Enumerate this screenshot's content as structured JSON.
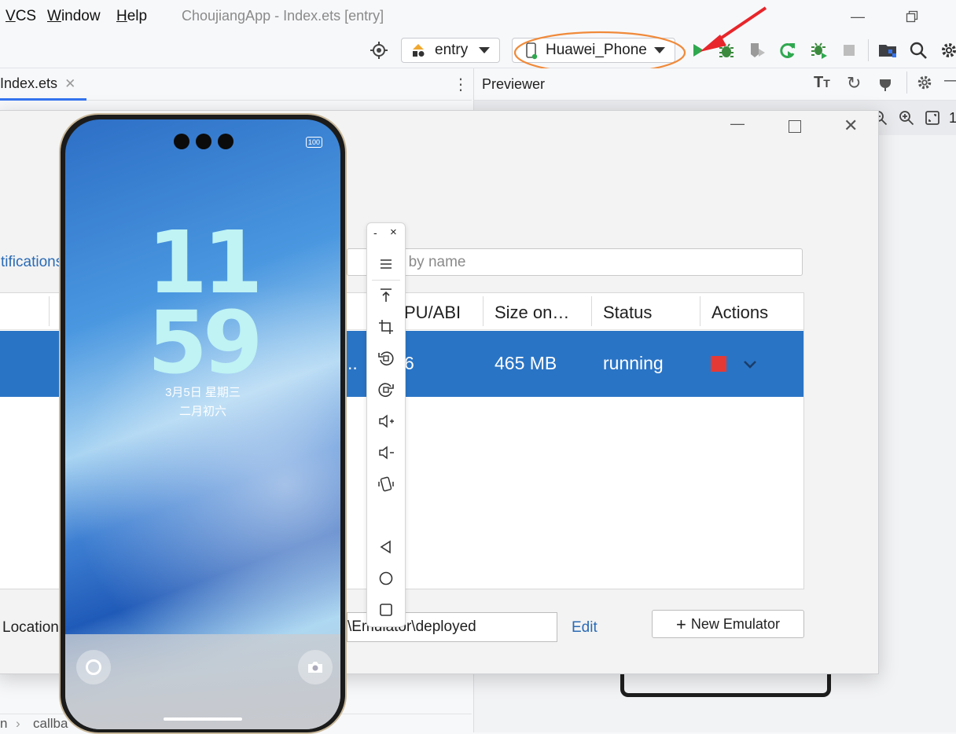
{
  "menu": {
    "items": [
      "VCS",
      "Window",
      "Help"
    ],
    "app_title": "ChoujiangApp - Index.ets [entry]"
  },
  "toolbar": {
    "module_selector": "entry",
    "device_selector": "Huawei_Phone",
    "accent": "#3574f0",
    "highlight_circle_color": "#f08a3a",
    "arrow_color": "#e8252a",
    "run_color": "#2fa84f"
  },
  "editor": {
    "tab_label": "Index.ets",
    "breadcrumb": "callba",
    "breadcrumb_prefix": "n"
  },
  "previewer": {
    "title": "Previewer",
    "zoom_partial": "1"
  },
  "device_manager": {
    "left_link_partial": "tifications",
    "search_placeholder": "r by name",
    "columns": [
      "PU/ABI",
      "Size on…",
      "Status",
      "Actions"
    ],
    "rows": [
      {
        "abi_partial": "6",
        "left_ellipsis": "..",
        "size": "465 MB",
        "status": "running",
        "stop_color": "#e53935"
      }
    ],
    "selection_color": "#2a74c5",
    "location_label": "Location",
    "location_value": "\\Emulator\\deployed",
    "edit_link": "Edit",
    "new_emulator_button": "New Emulator"
  },
  "phone": {
    "battery": "100",
    "clock_hours": "11",
    "clock_minutes": "59",
    "date": "3月5日  星期三",
    "lunar_date": "二月初六"
  },
  "side_controls": {
    "window_minimize": "-",
    "window_close": "×",
    "icons": [
      "menu-icon",
      "pin-top-icon",
      "crop-icon",
      "rotate-left-icon",
      "rotate-right-icon",
      "volume-up-icon",
      "volume-down-icon",
      "shake-icon",
      "back-icon",
      "home-icon",
      "recents-icon"
    ]
  }
}
